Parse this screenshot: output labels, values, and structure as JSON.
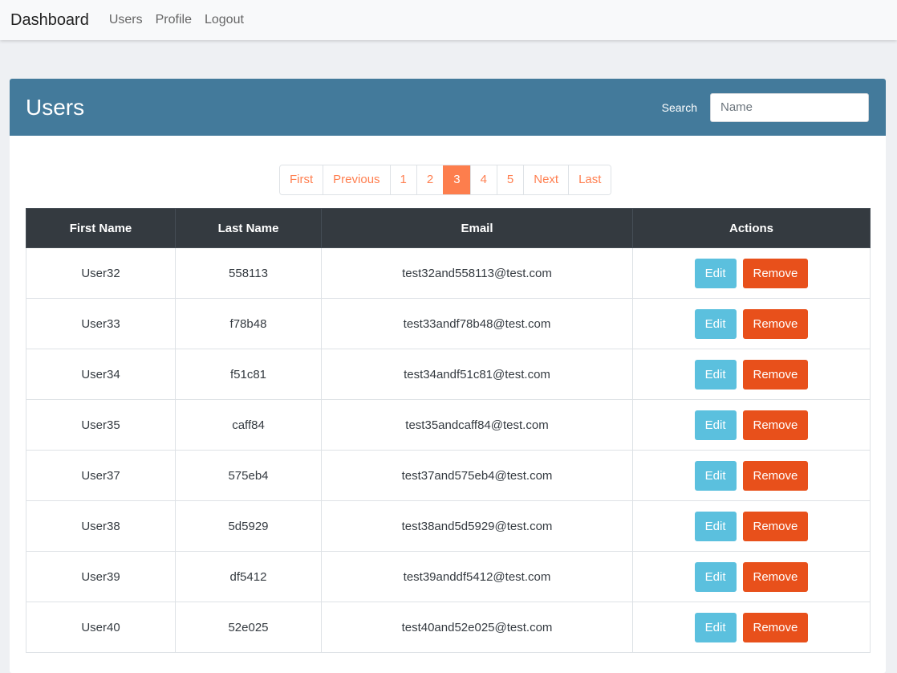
{
  "navbar": {
    "brand": "Dashboard",
    "links": [
      "Users",
      "Profile",
      "Logout"
    ]
  },
  "card": {
    "title": "Users",
    "search_label": "Search",
    "search_placeholder": "Name",
    "search_value": "",
    "header_color": "#437a9b"
  },
  "pagination": {
    "items": [
      "First",
      "Previous",
      "1",
      "2",
      "3",
      "4",
      "5",
      "Next",
      "Last"
    ],
    "active": "3",
    "accent_color": "#fd7e4d"
  },
  "table": {
    "columns": [
      "First Name",
      "Last Name",
      "Email",
      "Actions"
    ],
    "edit_label": "Edit",
    "remove_label": "Remove",
    "rows": [
      {
        "first": "User32",
        "last": "558113",
        "email": "test32and558113@test.com"
      },
      {
        "first": "User33",
        "last": "f78b48",
        "email": "test33andf78b48@test.com"
      },
      {
        "first": "User34",
        "last": "f51c81",
        "email": "test34andf51c81@test.com"
      },
      {
        "first": "User35",
        "last": "caff84",
        "email": "test35andcaff84@test.com"
      },
      {
        "first": "User37",
        "last": "575eb4",
        "email": "test37and575eb4@test.com"
      },
      {
        "first": "User38",
        "last": "5d5929",
        "email": "test38and5d5929@test.com"
      },
      {
        "first": "User39",
        "last": "df5412",
        "email": "test39anddf5412@test.com"
      },
      {
        "first": "User40",
        "last": "52e025",
        "email": "test40and52e025@test.com"
      }
    ],
    "edit_color": "#5bc0de",
    "remove_color": "#e8501b"
  }
}
